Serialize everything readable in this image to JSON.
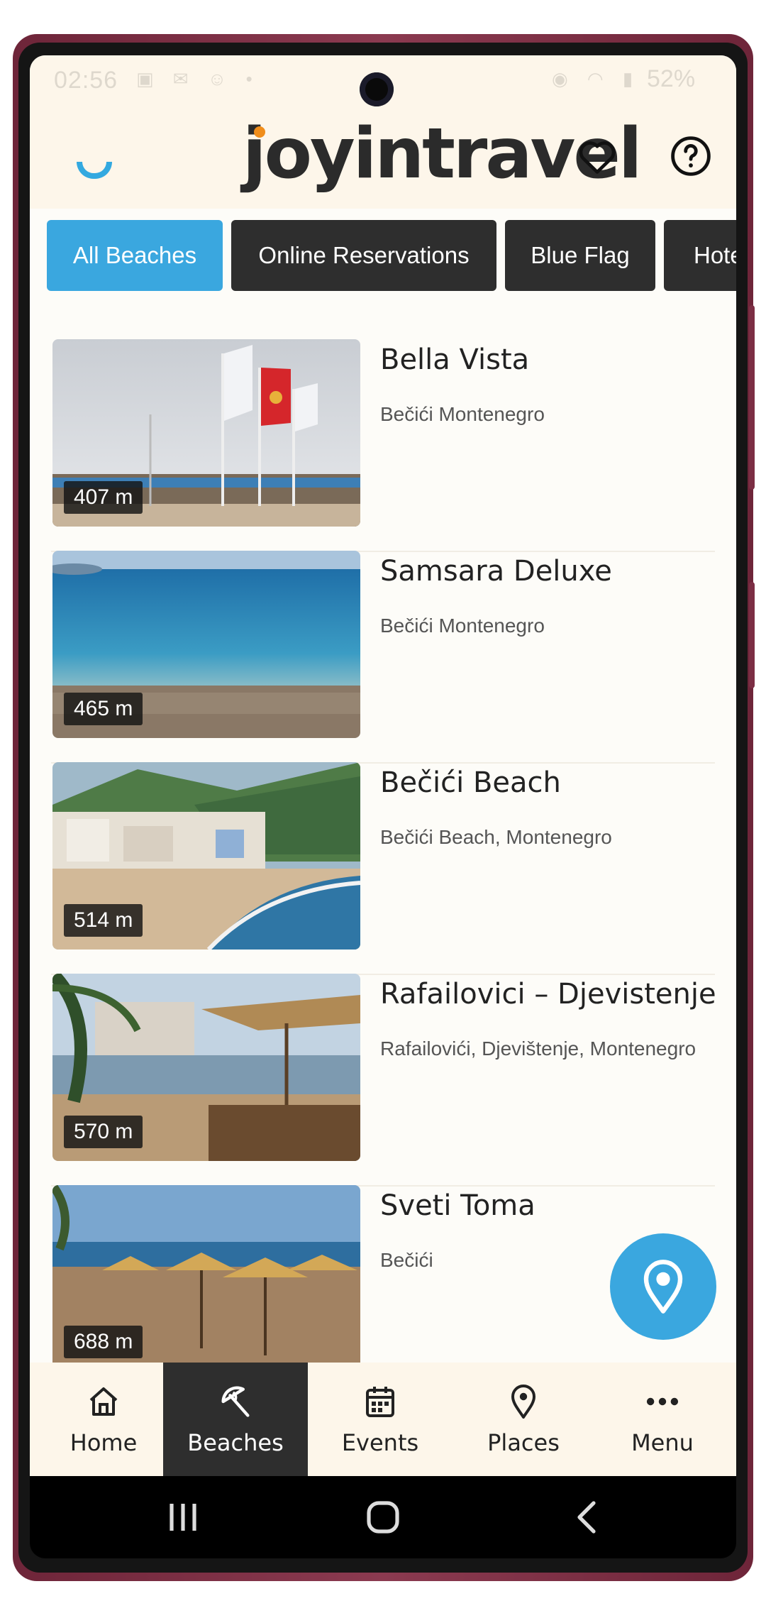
{
  "status_bar": {
    "time": "02:56",
    "battery": "52%"
  },
  "header": {
    "logo_text": "joyintravel",
    "favorites_icon": "heart-icon",
    "help_icon": "help-circle-icon"
  },
  "filters": [
    {
      "label": "All Beaches",
      "active": true
    },
    {
      "label": "Online Reservations",
      "active": false
    },
    {
      "label": "Blue Flag",
      "active": false
    },
    {
      "label": "Hotels",
      "active": false
    }
  ],
  "beaches": [
    {
      "name": "Bella Vista",
      "location": "Bečići Montenegro",
      "distance": "407 m"
    },
    {
      "name": "Samsara Deluxe",
      "location": "Bečići Montenegro",
      "distance": "465 m"
    },
    {
      "name": "Bečići Beach",
      "location": "Bečići Beach, Montenegro",
      "distance": "514 m"
    },
    {
      "name": "Rafailovici – Djevistenje",
      "location": "Rafailovići, Djevištenje, Montenegro",
      "distance": "570 m"
    },
    {
      "name": "Sveti Toma",
      "location": "Bečići",
      "distance": "688 m"
    }
  ],
  "fab": {
    "icon": "map-pin-icon"
  },
  "bottom_nav": [
    {
      "label": "Home",
      "icon": "home-icon",
      "active": false
    },
    {
      "label": "Beaches",
      "icon": "beach-umbrella-icon",
      "active": true
    },
    {
      "label": "Events",
      "icon": "calendar-icon",
      "active": false
    },
    {
      "label": "Places",
      "icon": "map-pin-icon",
      "active": false
    },
    {
      "label": "Menu",
      "icon": "more-icon",
      "active": false
    }
  ],
  "colors": {
    "accent": "#3aa7df",
    "dark_chip": "#2e2e2e",
    "header_bg": "#fdf6ea",
    "logo_orange": "#f08d1a"
  }
}
